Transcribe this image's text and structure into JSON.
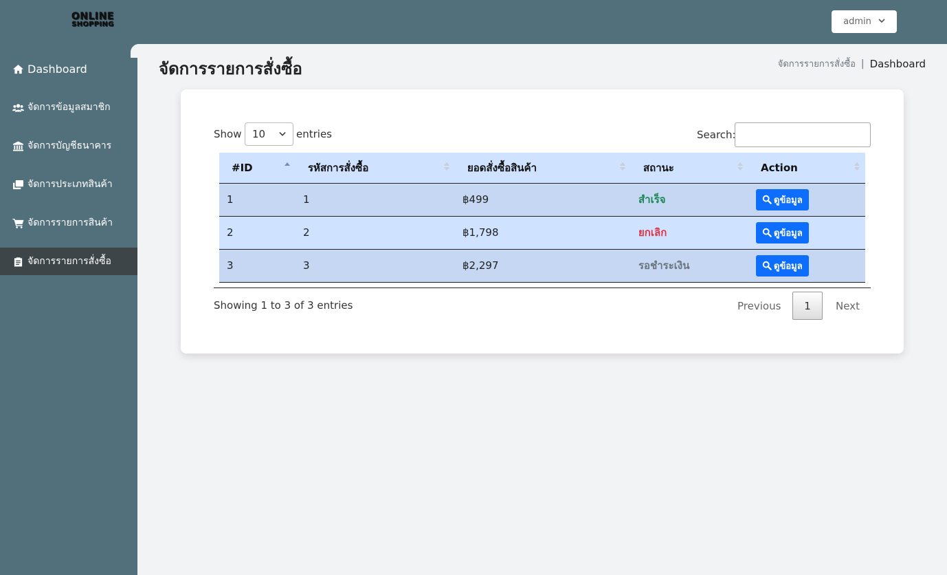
{
  "header": {
    "logo_line1": "ONLINE",
    "logo_line2": "SHOPPING",
    "user_label": "admin"
  },
  "sidebar": {
    "items": [
      {
        "label": "Dashboard",
        "icon": "home-icon"
      },
      {
        "label": "จัดการข้อมูลสมาชิก",
        "icon": "users-icon"
      },
      {
        "label": "จัดการบัญชีธนาคาร",
        "icon": "bank-icon"
      },
      {
        "label": "จัดการประเภทสินค้า",
        "icon": "clone-icon"
      },
      {
        "label": "จัดการรายการสินค้า",
        "icon": "cart-icon"
      },
      {
        "label": "จัดการรายการสั่งซื้อ",
        "icon": "clipboard-icon",
        "active": true
      }
    ]
  },
  "page": {
    "title": "จัดการรายการสั่งซื้อ",
    "breadcrumb": {
      "link": "จัดการรายการสั่งซื้อ",
      "separator": "|",
      "current": "Dashboard"
    }
  },
  "table_controls": {
    "show_label": "Show",
    "page_size": "10",
    "entries_label": "entries",
    "search_label": "Search:",
    "search_value": ""
  },
  "table": {
    "columns": [
      "#ID",
      "รหัสการสั่งซื้อ",
      "ยอดสั่งซื้อสินค้า",
      "สถานะ",
      "Action"
    ],
    "rows": [
      {
        "id": "1",
        "order_code": "1",
        "total": "฿499",
        "status": "สำเร็จ",
        "action": "ดูข้อมูล"
      },
      {
        "id": "2",
        "order_code": "2",
        "total": "฿1,798",
        "status": "ยกเลิก",
        "action": "ดูข้อมูล"
      },
      {
        "id": "3",
        "order_code": "3",
        "total": "฿2,297",
        "status": "รอชำระเงิน",
        "action": "ดูข้อมูล"
      }
    ]
  },
  "footer": {
    "info": "Showing 1 to 3 of 3 entries",
    "previous": "Previous",
    "page": "1",
    "next": "Next"
  },
  "colors": {
    "sidebar_bg": "#52707c",
    "active_item_bg": "#3d4548",
    "header_row_bg": "#cfe2ff",
    "primary_button": "#0d6efd",
    "status_success": "#198754",
    "status_cancel": "#dc3545",
    "status_waiting": "#6c757d"
  }
}
